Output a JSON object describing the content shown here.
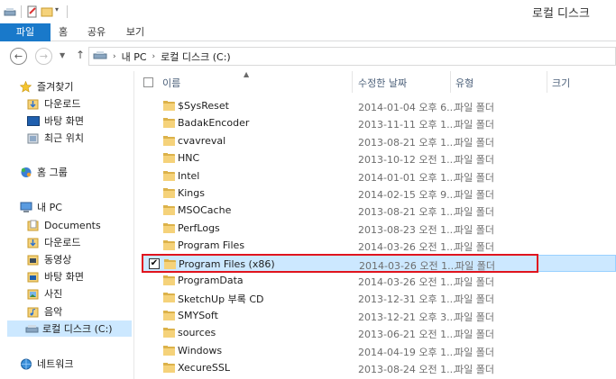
{
  "window": {
    "title": "로컬 디스크"
  },
  "ribbon": {
    "tabs": [
      {
        "label": "파일"
      },
      {
        "label": "홈"
      },
      {
        "label": "공유"
      },
      {
        "label": "보기"
      }
    ]
  },
  "address": {
    "crumbs": [
      "내 PC",
      "로컬 디스크 (C:)"
    ]
  },
  "sidebar": {
    "favorites": {
      "label": "즐겨찾기",
      "items": [
        {
          "label": "다운로드",
          "icon": "download-folder-icon"
        },
        {
          "label": "바탕 화면",
          "icon": "desktop-icon"
        },
        {
          "label": "최근 위치",
          "icon": "recent-places-icon"
        }
      ]
    },
    "homegroup": {
      "label": "홈 그룹"
    },
    "thispc": {
      "label": "내 PC",
      "items": [
        {
          "label": "Documents",
          "icon": "documents-icon"
        },
        {
          "label": "다운로드",
          "icon": "download-folder-icon"
        },
        {
          "label": "동영상",
          "icon": "videos-icon"
        },
        {
          "label": "바탕 화면",
          "icon": "desktop-icon"
        },
        {
          "label": "사진",
          "icon": "pictures-icon"
        },
        {
          "label": "음악",
          "icon": "music-icon"
        },
        {
          "label": "로컬 디스크 (C:)",
          "icon": "local-disk-icon",
          "selected": true
        }
      ]
    },
    "network": {
      "label": "네트워크"
    }
  },
  "columns": {
    "name": "이름",
    "date": "수정한 날짜",
    "type": "유형",
    "size": "크기"
  },
  "files": [
    {
      "name": "$SysReset",
      "date": "2014-01-04 오후 6...",
      "type": "파일 폴더"
    },
    {
      "name": "BadakEncoder",
      "date": "2013-11-11 오후 1...",
      "type": "파일 폴더"
    },
    {
      "name": "cvavreval",
      "date": "2013-08-21 오후 1...",
      "type": "파일 폴더"
    },
    {
      "name": "HNC",
      "date": "2013-10-12 오전 1...",
      "type": "파일 폴더"
    },
    {
      "name": "Intel",
      "date": "2014-01-01 오후 1...",
      "type": "파일 폴더"
    },
    {
      "name": "Kings",
      "date": "2014-02-15 오후 9...",
      "type": "파일 폴더"
    },
    {
      "name": "MSOCache",
      "date": "2013-08-21 오후 1...",
      "type": "파일 폴더"
    },
    {
      "name": "PerfLogs",
      "date": "2013-08-23 오전 1...",
      "type": "파일 폴더"
    },
    {
      "name": "Program Files",
      "date": "2014-03-26 오전 1...",
      "type": "파일 폴더"
    },
    {
      "name": "Program Files (x86)",
      "date": "2014-03-26 오전 1...",
      "type": "파일 폴더",
      "selected": true
    },
    {
      "name": "ProgramData",
      "date": "2014-03-26 오전 1...",
      "type": "파일 폴더"
    },
    {
      "name": "SketchUp 부록 CD",
      "date": "2013-12-31 오후 1...",
      "type": "파일 폴더"
    },
    {
      "name": "SMYSoft",
      "date": "2013-12-21 오후 3...",
      "type": "파일 폴더"
    },
    {
      "name": "sources",
      "date": "2013-06-21 오전 1...",
      "type": "파일 폴더"
    },
    {
      "name": "Windows",
      "date": "2014-04-19 오후 1...",
      "type": "파일 폴더"
    },
    {
      "name": "XecureSSL",
      "date": "2013-08-24 오전 1...",
      "type": "파일 폴더"
    }
  ],
  "colors": {
    "file_tab": "#1979ca",
    "selection": "#cce8ff",
    "annotation_box": "#e0141e",
    "folder": "#dcb24a"
  }
}
